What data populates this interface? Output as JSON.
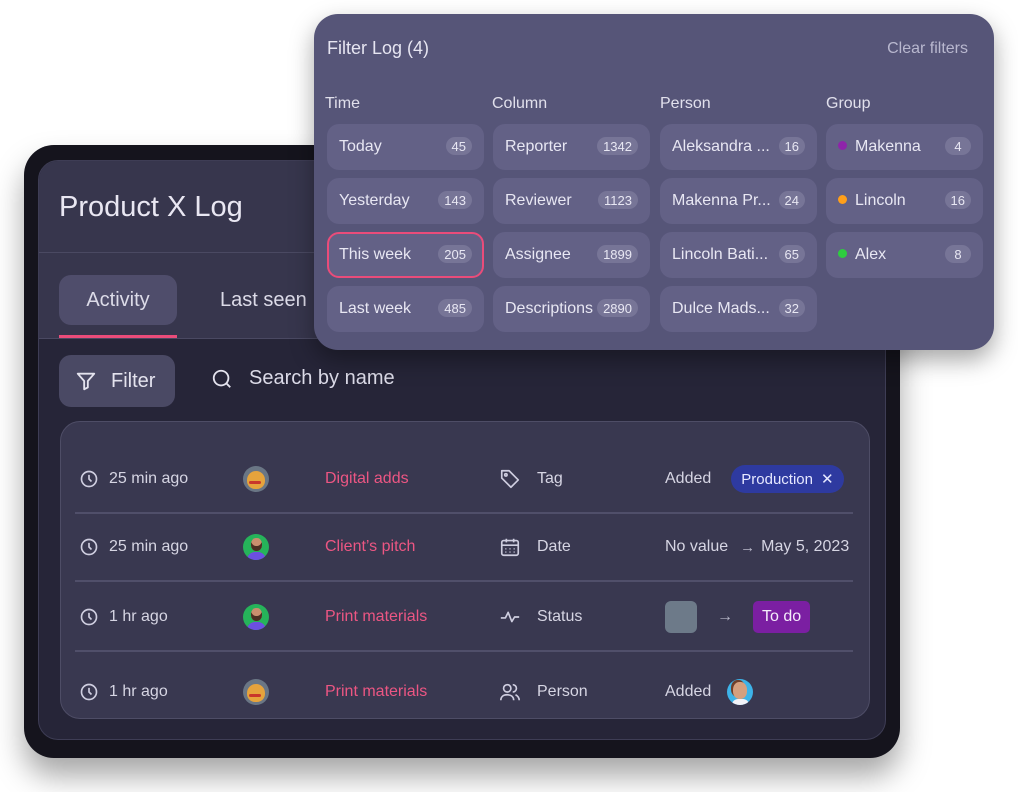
{
  "app": {
    "title": "Product X Log",
    "tabs": [
      {
        "label": "Activity",
        "active": true
      },
      {
        "label": "Last seen",
        "active": false
      }
    ],
    "filter_button": {
      "label": "Filter",
      "icon": "funnel-icon"
    },
    "search": {
      "placeholder": "Search by name",
      "icon": "search-icon"
    }
  },
  "log": {
    "rows": [
      {
        "time": "25 min ago",
        "avatar": "cat",
        "item": "Digital adds",
        "field": "Tag",
        "field_icon": "tag-icon",
        "change_type": "tag",
        "change_label": "Added",
        "tag": "Production",
        "tag_color": "#2e3aa0"
      },
      {
        "time": "25 min ago",
        "avatar": "man",
        "item": "Client’s pitch",
        "field": "Date",
        "field_icon": "calendar-icon",
        "change_type": "date",
        "from": "No value",
        "to": "May 5, 2023"
      },
      {
        "time": "1 hr ago",
        "avatar": "man",
        "item": "Print materials",
        "field": "Status",
        "field_icon": "activity-icon",
        "change_type": "status",
        "from_color": "#6d7a89",
        "to": "To do",
        "to_color": "#7b1fa2"
      },
      {
        "time": "1 hr ago",
        "avatar": "cat",
        "item": "Print materials",
        "field": "Person",
        "field_icon": "users-icon",
        "change_type": "person",
        "change_label": "Added",
        "person_avatar": "woman"
      }
    ]
  },
  "filter_popup": {
    "title": "Filter Log (4)",
    "clear_label": "Clear filters",
    "columns": [
      {
        "title": "Time",
        "items": [
          {
            "label": "Today",
            "count": "45"
          },
          {
            "label": "Yesterday",
            "count": "143"
          },
          {
            "label": "This week",
            "count": "205",
            "selected": true
          },
          {
            "label": "Last week",
            "count": "485"
          }
        ]
      },
      {
        "title": "Column",
        "items": [
          {
            "label": "Reporter",
            "count": "1342"
          },
          {
            "label": "Reviewer",
            "count": "1123"
          },
          {
            "label": "Assignee",
            "count": "1899"
          },
          {
            "label": "Descriptions",
            "count": "2890"
          }
        ]
      },
      {
        "title": "Person",
        "items": [
          {
            "label": "Aleksandra ...",
            "count": "16"
          },
          {
            "label": "Makenna Pr...",
            "count": "24"
          },
          {
            "label": "Lincoln Bati...",
            "count": "65"
          },
          {
            "label": "Dulce Mads...",
            "count": "32"
          }
        ]
      },
      {
        "title": "Group",
        "items": [
          {
            "label": "Makenna",
            "count": "4",
            "dot_color": "#8e24aa"
          },
          {
            "label": "Lincoln",
            "count": "16",
            "dot_color": "#ff9f1a"
          },
          {
            "label": "Alex",
            "count": "8",
            "dot_color": "#2ecc40"
          }
        ]
      }
    ]
  },
  "colors": {
    "accent": "#ea4c7a",
    "item_link": "#ec5683",
    "popup_bg": "#565578",
    "screen_bg": "#262538"
  }
}
